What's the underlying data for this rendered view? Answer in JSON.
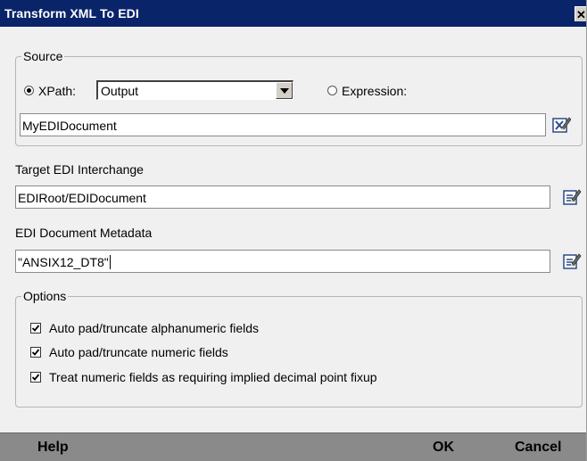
{
  "window": {
    "title": "Transform XML To EDI",
    "close_glyph": "✕"
  },
  "source": {
    "legend": "Source",
    "xpath_label": "XPath:",
    "xpath_selected": "Output",
    "expression_label": "Expression:",
    "value": "MyEDIDocument"
  },
  "target": {
    "label": "Target EDI Interchange",
    "value": "EDIRoot/EDIDocument"
  },
  "metadata": {
    "label": "EDI Document Metadata",
    "value": "\"ANSIX12_DT8\""
  },
  "options": {
    "legend": "Options",
    "items": [
      {
        "label": "Auto pad/truncate alphanumeric fields",
        "checked": true
      },
      {
        "label": "Auto pad/truncate numeric fields",
        "checked": true
      },
      {
        "label": "Treat numeric fields as requiring implied decimal point fixup",
        "checked": true
      }
    ]
  },
  "footer": {
    "help_label": "Help",
    "ok_label": "OK",
    "cancel_label": "Cancel"
  },
  "colors": {
    "titlebar": "#0a246a",
    "footer": "#8a8a8a",
    "dialog_bg": "#f0f0f0"
  },
  "icons": {
    "edit": "edit-pencil-icon",
    "xpath_edit": "xpath-edit-icon"
  }
}
